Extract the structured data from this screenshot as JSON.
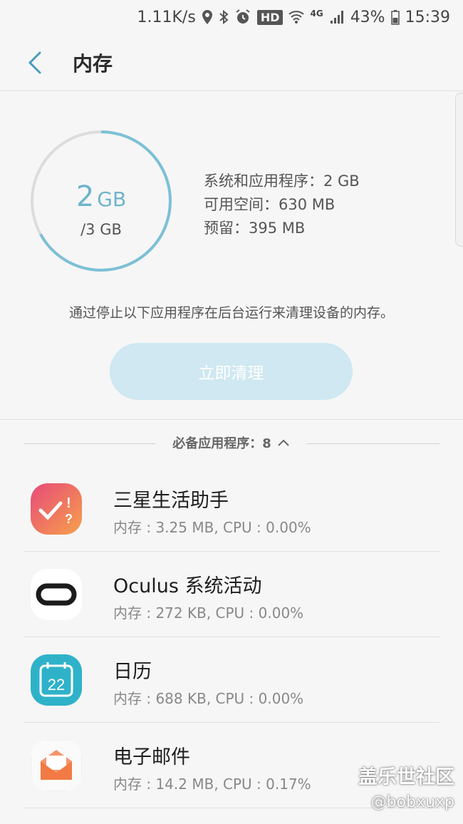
{
  "status_bar": {
    "speed": "1.11K/s",
    "hd": "HD",
    "network": "4G",
    "battery": "43%",
    "time": "15:39"
  },
  "header": {
    "title": "内存"
  },
  "memory": {
    "used_value": "2",
    "used_unit": "GB",
    "total": "/3 GB",
    "used_fraction": 0.67,
    "ring_color": "#7cc0d6",
    "stats": {
      "system_apps": "系统和应用程序：2 GB",
      "available": "可用空间：630 MB",
      "reserved": "预留：395 MB"
    }
  },
  "description": "通过停止以下应用程序在后台运行来清理设备的内存。",
  "clean_button": {
    "label": "立即清理"
  },
  "section": {
    "label": "必备应用程序：8"
  },
  "apps": [
    {
      "name": "三星生活助手",
      "detail": "内存 : 3.25 MB, CPU : 0.00%"
    },
    {
      "name": "Oculus 系统活动",
      "detail": "内存 : 272 KB, CPU : 0.00%"
    },
    {
      "name": "日历",
      "detail": "内存 : 688 KB, CPU : 0.00%",
      "icon_text": "22"
    },
    {
      "name": "电子邮件",
      "detail": "内存 : 14.2 MB, CPU : 0.17%"
    }
  ],
  "watermark": {
    "line1": "盖乐世社区",
    "line2": "@bobxuxp"
  }
}
